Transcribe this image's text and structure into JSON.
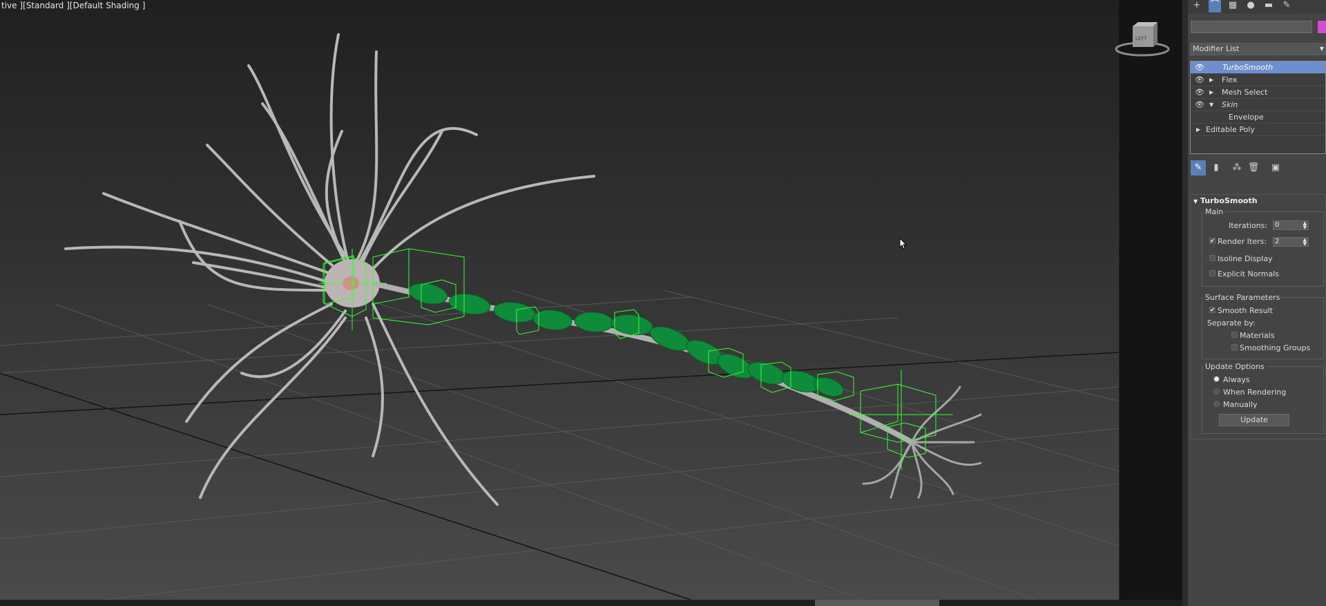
{
  "viewport": {
    "label": "tive ][Standard ][Default Shading ]",
    "viewcube_text": "LEFT"
  },
  "command_panel": {
    "tabs": [
      "create-icon",
      "modify-icon",
      "hierarchy-icon",
      "motion-icon",
      "display-icon",
      "utilities-icon"
    ],
    "object_color": "#d24dd2",
    "modifier_list_label": "Modifier List",
    "stack": [
      {
        "label": "TurboSmooth",
        "selected": true,
        "italic": true,
        "has_eye": true,
        "expand": ""
      },
      {
        "label": "Flex",
        "selected": false,
        "italic": false,
        "has_eye": true,
        "expand": "right"
      },
      {
        "label": "Mesh Select",
        "selected": false,
        "italic": false,
        "has_eye": true,
        "expand": "right"
      },
      {
        "label": "Skin",
        "selected": false,
        "italic": true,
        "has_eye": true,
        "expand": "down"
      },
      {
        "label": "Envelope",
        "selected": false,
        "italic": false,
        "has_eye": false,
        "expand": ""
      },
      {
        "label": "Editable Poly",
        "selected": false,
        "italic": false,
        "has_eye": false,
        "expand": "right"
      }
    ],
    "turbosmooth": {
      "title": "TurboSmooth",
      "main_group": "Main",
      "iterations_label": "Iterations:",
      "iterations_value": "0",
      "render_iters_label": "Render Iters:",
      "render_iters_value": "2",
      "render_iters_checked": true,
      "isoline_label": "Isoline Display",
      "explicit_normals_label": "Explicit Normals",
      "surface_group": "Surface Parameters",
      "smooth_result_label": "Smooth Result",
      "separate_by_label": "Separate by:",
      "materials_label": "Materials",
      "smoothing_groups_label": "Smoothing Groups",
      "update_group": "Update Options",
      "always_label": "Always",
      "when_rendering_label": "When Rendering",
      "manually_label": "Manually",
      "update_button": "Update"
    }
  }
}
